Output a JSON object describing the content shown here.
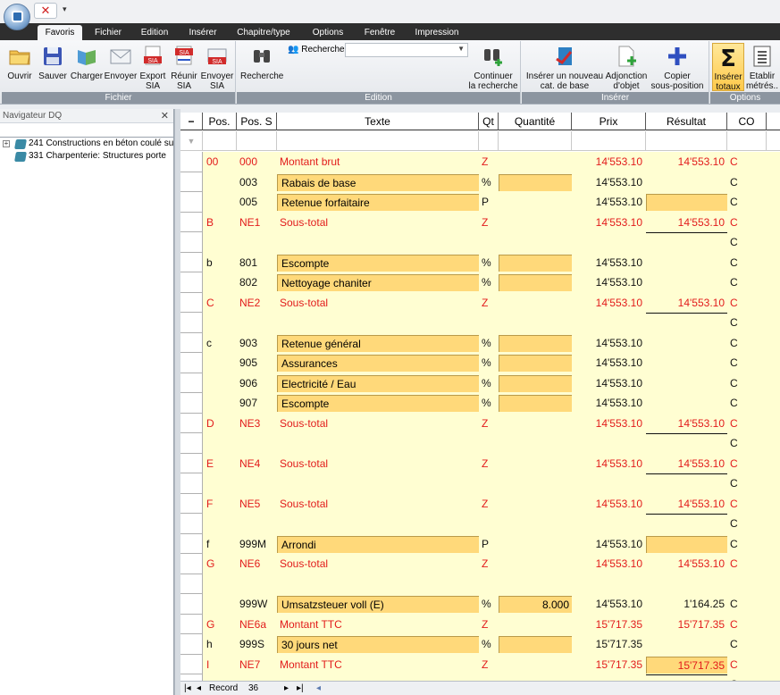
{
  "ribbon_tabs": [
    "Favoris",
    "Fichier",
    "Edition",
    "Insérer",
    "Chapitre/type",
    "Options",
    "Fenêtre",
    "Impression"
  ],
  "ribbon": {
    "fichier": {
      "label": "Fichier",
      "buttons": [
        "Ouvrir",
        "Sauver",
        "Charger",
        "Envoyer"
      ],
      "export_sia": [
        "Export",
        "SIA"
      ],
      "reunir_sia": [
        "Réunir",
        "SIA"
      ],
      "envoyer_sia": [
        "Envoyer",
        "SIA"
      ]
    },
    "edition": {
      "label": "Edition",
      "recherche": "Recherche",
      "rechercher_label": "Rechercher",
      "search_value": "",
      "continuer": [
        "Continuer",
        "la recherche"
      ]
    },
    "inserer": {
      "label": "Insérer",
      "nouveau": [
        "Insérer un nouveau",
        "cat. de base"
      ],
      "adjonction": [
        "Adjonction",
        "d'objet"
      ],
      "copier": [
        "Copier",
        "sous-position"
      ]
    },
    "options": {
      "label": "Options",
      "totaux": [
        "Insérer",
        "totaux"
      ],
      "metres": [
        "Etablir",
        "métrés.."
      ]
    }
  },
  "icons": {
    "qat": "close-x-icon",
    "open": "folder-icon",
    "save": "floppy-icon",
    "load": "load-icon",
    "send": "envelope-icon",
    "search": "binoculars-icon",
    "sigma": "sigma-icon"
  },
  "nav": {
    "title": "Navigateur DQ",
    "items": [
      {
        "text": "241 Constructions en béton coulé  su"
      },
      {
        "text": "331 Charpenterie: Structures       porte"
      }
    ]
  },
  "grid": {
    "headers": [
      "−",
      "Pos.",
      "Pos. S",
      "Texte",
      "Qt",
      "Quantité",
      "Prix",
      "Résultat",
      "CO"
    ],
    "filter_icon": "filter-icon",
    "rows": [
      {
        "pos": "00",
        "poss": "000",
        "texte": "Montant brut",
        "qt": "Z",
        "quantite": "",
        "prix": "14'553.10",
        "resultat": "14'553.10",
        "co": "C",
        "red": true
      },
      {
        "pos": "",
        "poss": "003",
        "texte": "Rabais de base",
        "qt": "%",
        "quantite": "",
        "prix": "14'553.10",
        "resultat": "",
        "co": "C",
        "edit_text": true,
        "edit_q": true
      },
      {
        "pos": "",
        "poss": "005",
        "texte": "Retenue forfaitaire",
        "qt": "P",
        "quantite": "",
        "prix": "14'553.10",
        "resultat": "",
        "co": "C",
        "edit_text": true,
        "edit_r": true
      },
      {
        "pos": "B",
        "poss": "NE1",
        "texte": "Sous-total",
        "qt": "Z",
        "quantite": "",
        "prix": "14'553.10",
        "resultat": "14'553.10",
        "co": "C",
        "red": true
      },
      {
        "pos": "",
        "poss": "",
        "texte": "",
        "qt": "",
        "quantite": "",
        "prix": "",
        "resultat": "",
        "co": "C",
        "underline": true
      },
      {
        "pos": "b",
        "poss": "801",
        "texte": "Escompte",
        "qt": "%",
        "quantite": "",
        "prix": "14'553.10",
        "resultat": "",
        "co": "C",
        "edit_text": true,
        "edit_q": true
      },
      {
        "pos": "",
        "poss": "802",
        "texte": "Nettoyage chaniter",
        "qt": "%",
        "quantite": "",
        "prix": "14'553.10",
        "resultat": "",
        "co": "C",
        "edit_text": true,
        "edit_q": true
      },
      {
        "pos": "C",
        "poss": "NE2",
        "texte": "Sous-total",
        "qt": "Z",
        "quantite": "",
        "prix": "14'553.10",
        "resultat": "14'553.10",
        "co": "C",
        "red": true
      },
      {
        "pos": "",
        "poss": "",
        "texte": "",
        "qt": "",
        "quantite": "",
        "prix": "",
        "resultat": "",
        "co": "C",
        "underline": true
      },
      {
        "pos": "c",
        "poss": "903",
        "texte": "Retenue général",
        "qt": "%",
        "quantite": "",
        "prix": "14'553.10",
        "resultat": "",
        "co": "C",
        "edit_text": true,
        "edit_q": true
      },
      {
        "pos": "",
        "poss": "905",
        "texte": "Assurances",
        "qt": "%",
        "quantite": "",
        "prix": "14'553.10",
        "resultat": "",
        "co": "C",
        "edit_text": true,
        "edit_q": true
      },
      {
        "pos": "",
        "poss": "906",
        "texte": "Electricité / Eau",
        "qt": "%",
        "quantite": "",
        "prix": "14'553.10",
        "resultat": "",
        "co": "C",
        "edit_text": true,
        "edit_q": true
      },
      {
        "pos": "",
        "poss": "907",
        "texte": "Escompte",
        "qt": "%",
        "quantite": "",
        "prix": "14'553.10",
        "resultat": "",
        "co": "C",
        "edit_text": true,
        "edit_q": true
      },
      {
        "pos": "D",
        "poss": "NE3",
        "texte": "Sous-total",
        "qt": "Z",
        "quantite": "",
        "prix": "14'553.10",
        "resultat": "14'553.10",
        "co": "C",
        "red": true
      },
      {
        "pos": "",
        "poss": "",
        "texte": "",
        "qt": "",
        "quantite": "",
        "prix": "",
        "resultat": "",
        "co": "C",
        "underline": true
      },
      {
        "pos": "E",
        "poss": "NE4",
        "texte": "Sous-total",
        "qt": "Z",
        "quantite": "",
        "prix": "14'553.10",
        "resultat": "14'553.10",
        "co": "C",
        "red": true
      },
      {
        "pos": "",
        "poss": "",
        "texte": "",
        "qt": "",
        "quantite": "",
        "prix": "",
        "resultat": "",
        "co": "C",
        "underline": true
      },
      {
        "pos": "F",
        "poss": "NE5",
        "texte": "Sous-total",
        "qt": "Z",
        "quantite": "",
        "prix": "14'553.10",
        "resultat": "14'553.10",
        "co": "C",
        "red": true
      },
      {
        "pos": "",
        "poss": "",
        "texte": "",
        "qt": "",
        "quantite": "",
        "prix": "",
        "resultat": "",
        "co": "C",
        "underline": true
      },
      {
        "pos": "f",
        "poss": "999M",
        "texte": "Arrondi",
        "qt": "P",
        "quantite": "",
        "prix": "14'553.10",
        "resultat": "",
        "co": "C",
        "edit_text": true,
        "edit_r": true
      },
      {
        "pos": "G",
        "poss": "NE6",
        "texte": "Sous-total",
        "qt": "Z",
        "quantite": "",
        "prix": "14'553.10",
        "resultat": "14'553.10",
        "co": "C",
        "red": true
      },
      {
        "pos": "",
        "poss": "",
        "texte": "",
        "qt": "",
        "quantite": "",
        "prix": "",
        "resultat": "",
        "co": ""
      },
      {
        "pos": "",
        "poss": "999W",
        "texte": "Umsatzsteuer voll (E)",
        "qt": "%",
        "quantite": "8.000",
        "prix": "14'553.10",
        "resultat": "1'164.25",
        "co": "C",
        "edit_text": true,
        "edit_q": true
      },
      {
        "pos": "G",
        "poss": "NE6a",
        "texte": "Montant TTC",
        "qt": "Z",
        "quantite": "",
        "prix": "15'717.35",
        "resultat": "15'717.35",
        "co": "C",
        "red": true
      },
      {
        "pos": "h",
        "poss": "999S",
        "texte": "30 jours net",
        "qt": "%",
        "quantite": "",
        "prix": "15'717.35",
        "resultat": "",
        "co": "C",
        "edit_text": true,
        "edit_q": true
      },
      {
        "pos": "I",
        "poss": "NE7",
        "texte": "Montant TTC",
        "qt": "Z",
        "quantite": "",
        "prix": "15'717.35",
        "resultat": "15'717.35",
        "co": "C",
        "red": true,
        "edit_r": true
      },
      {
        "pos": "",
        "poss": "",
        "texte": "",
        "qt": "",
        "quantite": "",
        "prix": "",
        "resultat": "",
        "co": "C",
        "underline": true
      }
    ]
  },
  "status": {
    "record_label": "Record",
    "record_num": "36"
  }
}
